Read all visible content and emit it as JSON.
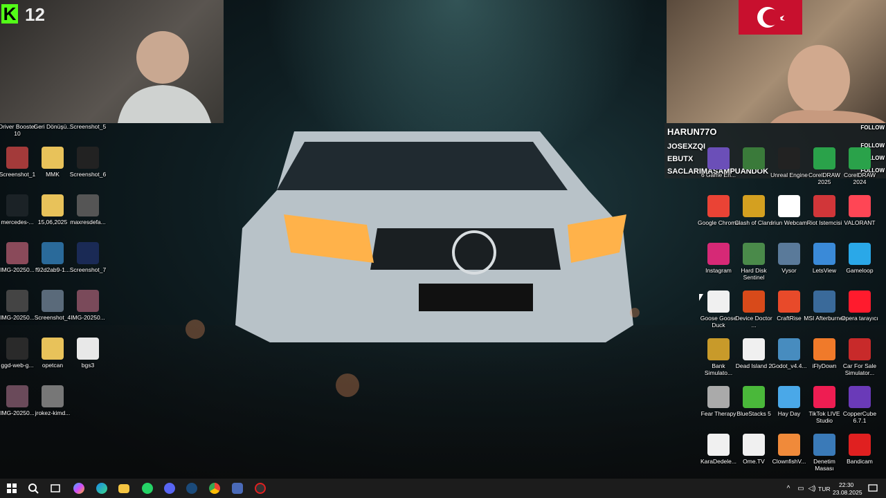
{
  "stream": {
    "viewer_count": "12",
    "kick_glyph": "K"
  },
  "chat": {
    "messages": [
      {
        "user": "HARUN77O",
        "follow": "FOLLOW"
      },
      {
        "user": "JOSEXZQI",
        "follow": "FOLLOW"
      },
      {
        "user": "EBUTX",
        "follow": "FOLLOW"
      },
      {
        "user": "SACLARIMASAMPUANDOK",
        "follow": "FOLLOW"
      }
    ]
  },
  "desktop_left": [
    {
      "label": "Driver Booster 10",
      "icon": "driver-booster-icon",
      "color": "#d83a2a"
    },
    {
      "label": "Geri Dönüşü...",
      "icon": "recycle-bin-icon",
      "color": "#7a8a99"
    },
    {
      "label": "Screenshot_5",
      "icon": "image-file-icon",
      "color": "#3b4a66"
    },
    {
      "label": "Screenshot_1",
      "icon": "image-file-icon",
      "color": "#a33a3a"
    },
    {
      "label": "MMK",
      "icon": "folder-icon",
      "color": "#e8c25a"
    },
    {
      "label": "Screenshot_6",
      "icon": "image-file-icon",
      "color": "#222"
    },
    {
      "label": "mercedes-...",
      "icon": "image-file-icon",
      "color": "#1b2226"
    },
    {
      "label": "15,06,2025",
      "icon": "folder-icon",
      "color": "#e8c25a"
    },
    {
      "label": "maxresdefa...",
      "icon": "image-file-icon",
      "color": "#555"
    },
    {
      "label": "IMG-20250...",
      "icon": "image-file-icon",
      "color": "#8a4a5a"
    },
    {
      "label": "f92d2ab9-1...",
      "icon": "image-file-icon",
      "color": "#2a6a9a"
    },
    {
      "label": "Screenshot_7",
      "icon": "image-file-icon",
      "color": "#1a2a55"
    },
    {
      "label": "IMG-20250...",
      "icon": "image-file-icon",
      "color": "#444"
    },
    {
      "label": "Screenshot_4",
      "icon": "image-file-icon",
      "color": "#5a6a7a"
    },
    {
      "label": "IMG-20250...",
      "icon": "image-file-icon",
      "color": "#7a4a5a"
    },
    {
      "label": "ggd-web-g...",
      "icon": "image-file-icon",
      "color": "#2a2a2a"
    },
    {
      "label": "opetcan",
      "icon": "folder-icon",
      "color": "#e8c25a"
    },
    {
      "label": "bgs3",
      "icon": "document-icon",
      "color": "#e8e8e8"
    },
    {
      "label": "IMG-20250...",
      "icon": "image-file-icon",
      "color": "#6a4a5a"
    },
    {
      "label": "jrokez-kimd...",
      "icon": "image-file-icon",
      "color": "#777"
    }
  ],
  "desktop_right": [
    {
      "label": "6 Game En...",
      "icon": "cube-icon",
      "color": "#6b4fb8"
    },
    {
      "label": "",
      "icon": "cube-icon",
      "color": "#3a7a3a"
    },
    {
      "label": "Unreal Engine",
      "icon": "unreal-icon",
      "color": "#222"
    },
    {
      "label": "CorelDRAW 2025",
      "icon": "coreldraw-icon",
      "color": "#2aa24a"
    },
    {
      "label": "CorelDRAW 2024",
      "icon": "coreldraw-icon",
      "color": "#2aa24a"
    },
    {
      "label": "Google Chrome",
      "icon": "chrome-icon",
      "color": "#ea4335"
    },
    {
      "label": "Clash of Clans",
      "icon": "clash-icon",
      "color": "#d4a020"
    },
    {
      "label": "Iriun Webcam",
      "icon": "webcam-icon",
      "color": "#ffffff"
    },
    {
      "label": "Riot Istemcisi",
      "icon": "riot-icon",
      "color": "#d13639"
    },
    {
      "label": "VALORANT",
      "icon": "valorant-icon",
      "color": "#ff4655"
    },
    {
      "label": "Instagram",
      "icon": "instagram-icon",
      "color": "#d62976"
    },
    {
      "label": "Hard Disk Sentinel",
      "icon": "disk-icon",
      "color": "#4a8a4a"
    },
    {
      "label": "Vysor",
      "icon": "vysor-icon",
      "color": "#5a7a9a"
    },
    {
      "label": "LetsView",
      "icon": "letsview-icon",
      "color": "#3a8ad8"
    },
    {
      "label": "Gameloop",
      "icon": "gameloop-icon",
      "color": "#2aa8e8"
    },
    {
      "label": "Goose Goose Duck",
      "icon": "goose-icon",
      "color": "#f0f0f0"
    },
    {
      "label": "Device Doctor ...",
      "icon": "device-doctor-icon",
      "color": "#d84a1a"
    },
    {
      "label": "CraftRise",
      "icon": "craftrise-icon",
      "color": "#e84a2a"
    },
    {
      "label": "MSI Afterburner",
      "icon": "msi-icon",
      "color": "#3a6a9a"
    },
    {
      "label": "Opera tarayıcı",
      "icon": "opera-icon",
      "color": "#ff1b2d"
    },
    {
      "label": "Bank Simulato...",
      "icon": "bank-icon",
      "color": "#c89a2a"
    },
    {
      "label": "Dead Island 2",
      "icon": "document-icon",
      "color": "#f0f0f0"
    },
    {
      "label": "Godot_v4.4...",
      "icon": "godot-icon",
      "color": "#478cbf"
    },
    {
      "label": "iFlyDown",
      "icon": "download-icon",
      "color": "#f07a2a"
    },
    {
      "label": "Car For Sale Simulator...",
      "icon": "cfs-icon",
      "color": "#c82a2a"
    },
    {
      "label": "Fear Therapy",
      "icon": "fear-icon",
      "color": "#aaaaaa"
    },
    {
      "label": "BlueStacks 5",
      "icon": "bluestacks-icon",
      "color": "#4ab83a"
    },
    {
      "label": "Hay Day",
      "icon": "hayday-icon",
      "color": "#4aa8e8"
    },
    {
      "label": "TikTok LIVE Studio",
      "icon": "tiktok-icon",
      "color": "#ee1d52"
    },
    {
      "label": "CopperCube 6.7.1",
      "icon": "coppercube-icon",
      "color": "#6a3ab8"
    },
    {
      "label": "KaraDedele...",
      "icon": "kd-icon",
      "color": "#f0f0f0"
    },
    {
      "label": "Ome.TV",
      "icon": "ometv-icon",
      "color": "#f0f0f0"
    },
    {
      "label": "ClownfishV...",
      "icon": "clownfish-icon",
      "color": "#f08a3a"
    },
    {
      "label": "Denetim Masası",
      "icon": "control-panel-icon",
      "color": "#3a7ab8"
    },
    {
      "label": "Bandicam",
      "icon": "bandicam-icon",
      "color": "#e02020"
    }
  ],
  "taskbar": {
    "language": "TUR",
    "time": "22:30",
    "date": "23.08.2025"
  }
}
